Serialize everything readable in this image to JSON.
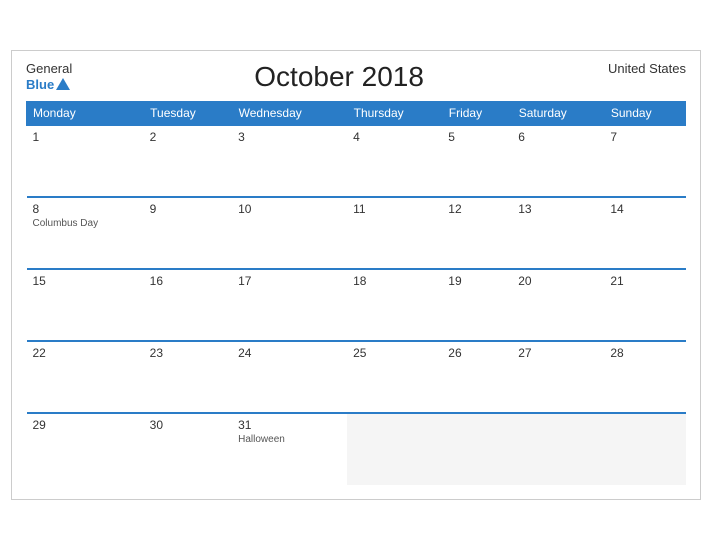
{
  "header": {
    "logo_general": "General",
    "logo_blue": "Blue",
    "title": "October 2018",
    "country": "United States"
  },
  "weekdays": [
    "Monday",
    "Tuesday",
    "Wednesday",
    "Thursday",
    "Friday",
    "Saturday",
    "Sunday"
  ],
  "weeks": [
    [
      {
        "day": "1",
        "event": ""
      },
      {
        "day": "2",
        "event": ""
      },
      {
        "day": "3",
        "event": ""
      },
      {
        "day": "4",
        "event": ""
      },
      {
        "day": "5",
        "event": ""
      },
      {
        "day": "6",
        "event": ""
      },
      {
        "day": "7",
        "event": ""
      }
    ],
    [
      {
        "day": "8",
        "event": "Columbus Day"
      },
      {
        "day": "9",
        "event": ""
      },
      {
        "day": "10",
        "event": ""
      },
      {
        "day": "11",
        "event": ""
      },
      {
        "day": "12",
        "event": ""
      },
      {
        "day": "13",
        "event": ""
      },
      {
        "day": "14",
        "event": ""
      }
    ],
    [
      {
        "day": "15",
        "event": ""
      },
      {
        "day": "16",
        "event": ""
      },
      {
        "day": "17",
        "event": ""
      },
      {
        "day": "18",
        "event": ""
      },
      {
        "day": "19",
        "event": ""
      },
      {
        "day": "20",
        "event": ""
      },
      {
        "day": "21",
        "event": ""
      }
    ],
    [
      {
        "day": "22",
        "event": ""
      },
      {
        "day": "23",
        "event": ""
      },
      {
        "day": "24",
        "event": ""
      },
      {
        "day": "25",
        "event": ""
      },
      {
        "day": "26",
        "event": ""
      },
      {
        "day": "27",
        "event": ""
      },
      {
        "day": "28",
        "event": ""
      }
    ],
    [
      {
        "day": "29",
        "event": ""
      },
      {
        "day": "30",
        "event": ""
      },
      {
        "day": "31",
        "event": "Halloween"
      },
      {
        "day": "",
        "event": ""
      },
      {
        "day": "",
        "event": ""
      },
      {
        "day": "",
        "event": ""
      },
      {
        "day": "",
        "event": ""
      }
    ]
  ]
}
